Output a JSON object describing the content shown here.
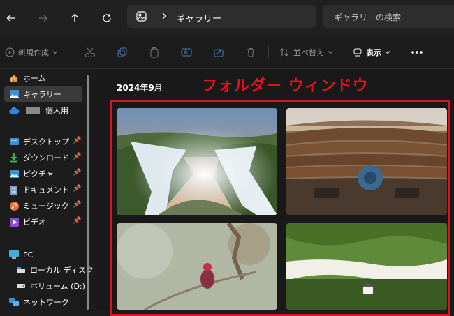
{
  "address_bar": {
    "breadcrumb": "ギャラリー",
    "search_placeholder": "ギャラリーの検索"
  },
  "toolbar": {
    "new_label": "新規作成",
    "sort_label": "並べ替え",
    "view_label": "表示"
  },
  "sidebar": {
    "home": "ホーム",
    "gallery": "ギャラリー",
    "personal": "個人用",
    "desktop": "デスクトップ",
    "downloads": "ダウンロード",
    "pictures": "ピクチャ",
    "documents": "ドキュメント",
    "music": "ミュージック",
    "videos": "ビデオ",
    "pc": "PC",
    "local_disk": "ローカル ディスク (",
    "volume_d": "ボリューム (D:)",
    "network": "ネットワーク"
  },
  "content": {
    "date_header": "2024年9月",
    "annotation": "フォルダー ウィンドウ"
  },
  "colors": {
    "annotation_red": "#e8101e",
    "selected_item": "#3a3a3a"
  }
}
